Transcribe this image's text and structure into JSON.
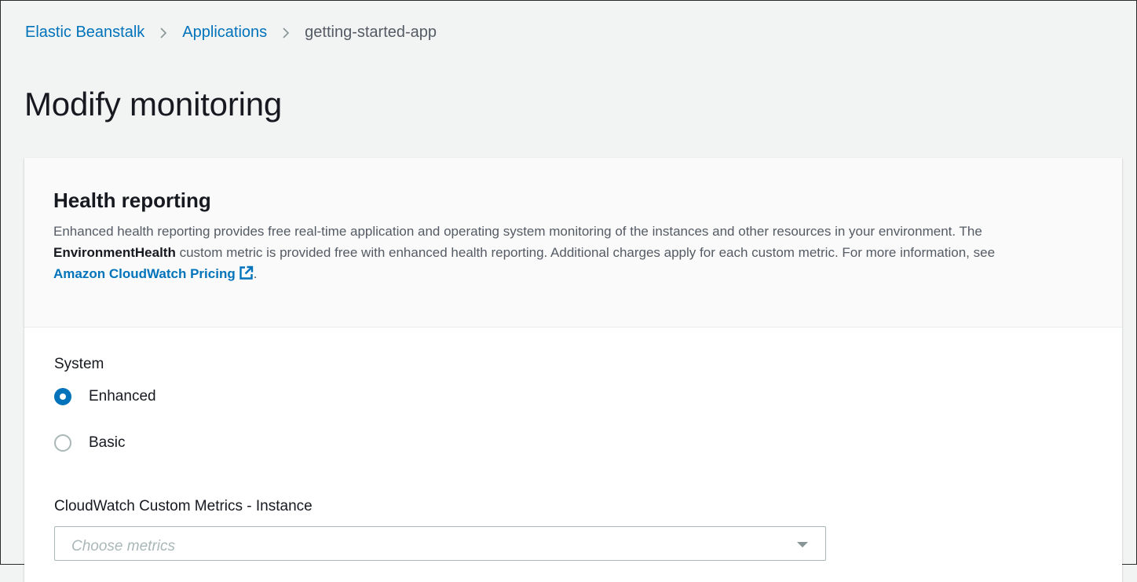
{
  "breadcrumb": {
    "items": [
      {
        "label": "Elastic Beanstalk"
      },
      {
        "label": "Applications"
      },
      {
        "label": "getting-started-app"
      }
    ]
  },
  "page": {
    "title": "Modify monitoring"
  },
  "health_reporting": {
    "title": "Health reporting",
    "desc_part1": "Enhanced health reporting provides free real-time application and operating system monitoring of the instances and other resources in your environment. The ",
    "desc_bold": "EnvironmentHealth",
    "desc_part2": " custom metric is provided free with enhanced health reporting. Additional charges apply for each custom metric. For more information, see ",
    "link_label": "Amazon CloudWatch Pricing",
    "desc_end": "."
  },
  "system": {
    "label": "System",
    "options": [
      {
        "label": "Enhanced",
        "selected": true
      },
      {
        "label": "Basic",
        "selected": false
      }
    ]
  },
  "custom_metrics": {
    "label": "CloudWatch Custom Metrics - Instance",
    "placeholder": "Choose metrics"
  },
  "colors": {
    "link": "#0073bb",
    "background": "#f2f3f3",
    "panel_header": "#fafafa"
  },
  "icons": {
    "external_link": "external-link-icon",
    "breadcrumb_separator": "chevron-right-icon",
    "dropdown": "caret-down-icon"
  }
}
